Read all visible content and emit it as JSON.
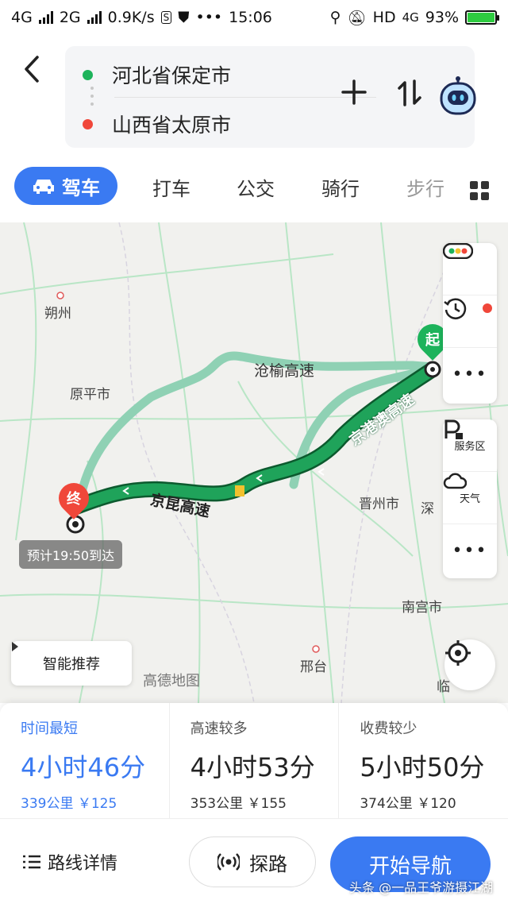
{
  "status": {
    "net1": "4G",
    "net2": "2G",
    "speed": "0.9K/s",
    "time": "15:06",
    "hd": "HD",
    "net3": "4G",
    "battery": "93%"
  },
  "header": {
    "from": "河北省保定市",
    "to": "山西省太原市"
  },
  "tabs": {
    "drive": "驾车",
    "taxi": "打车",
    "bus": "公交",
    "bike": "骑行",
    "walk": "步行"
  },
  "map": {
    "cities": {
      "shuozhou": "朔州",
      "yuanping": "原平市",
      "jinzhou": "晋州市",
      "shen": "深",
      "nangong": "南宫市",
      "xingtai": "邢台",
      "lin": "临"
    },
    "highways": {
      "cangyu": "沧榆高速",
      "jingkun": "京昆高速",
      "jinggangao": "京港澳高速"
    },
    "start_label": "起",
    "end_label": "终",
    "eta": "预计19:50到达",
    "side": {
      "service": "服务区",
      "weather": "天气"
    },
    "smart": "智能推荐",
    "watermark": "高德地图"
  },
  "routes": [
    {
      "tag": "时间最短",
      "time": "4小时46分",
      "meta": "339公里 ￥125"
    },
    {
      "tag": "高速较多",
      "time": "4小时53分",
      "meta": "353公里 ￥155"
    },
    {
      "tag": "收费较少",
      "time": "5小时50分",
      "meta": "374公里 ￥120"
    }
  ],
  "bottom": {
    "detail": "路线详情",
    "explore": "探路",
    "start_nav": "开始导航"
  },
  "credit": "头条 @一品王爷游摄江湖",
  "colors": {
    "accent": "#3a7af2",
    "route_primary": "#1fa35a",
    "route_alt": "#8fd1b4",
    "start": "#1db35b",
    "end": "#f0473a"
  }
}
